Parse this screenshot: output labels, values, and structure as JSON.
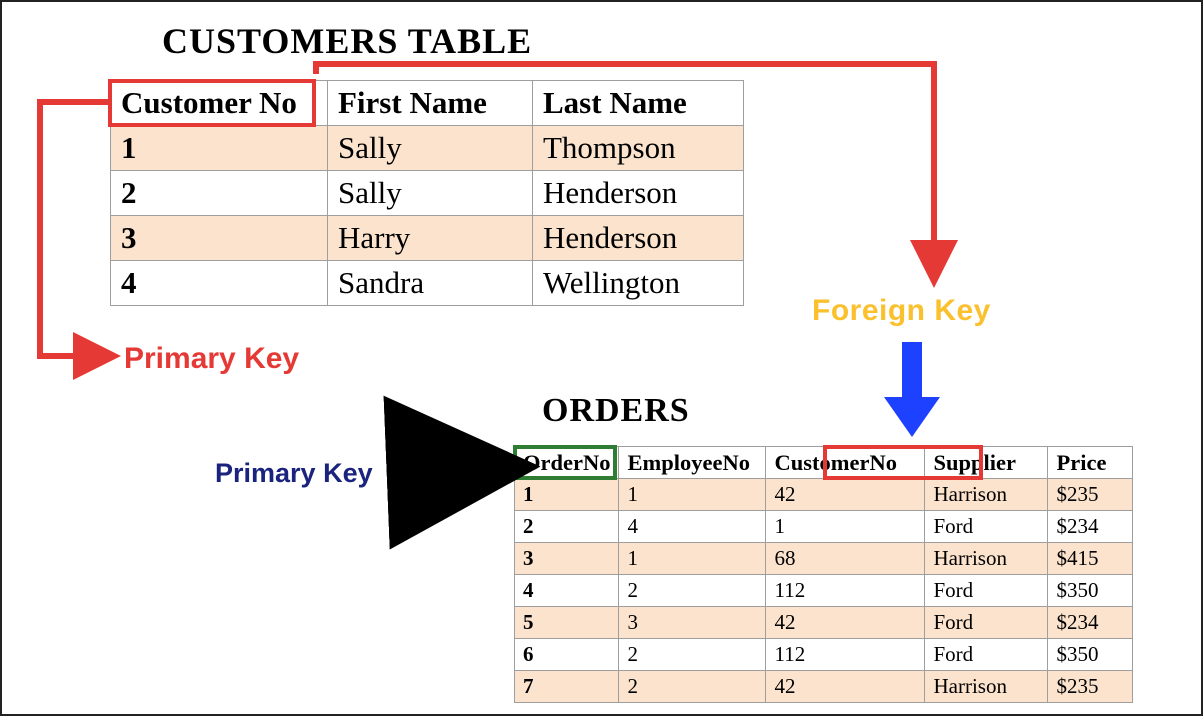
{
  "customers_table": {
    "title": "CUSTOMERS TABLE",
    "columns": [
      "Customer No",
      "First Name",
      "Last Name"
    ],
    "rows": [
      [
        "1",
        "Sally",
        "Thompson"
      ],
      [
        "2",
        "Sally",
        "Henderson"
      ],
      [
        "3",
        "Harry",
        "Henderson"
      ],
      [
        "4",
        "Sandra",
        "Wellington"
      ]
    ],
    "primary_key_column": 0
  },
  "orders_table": {
    "title": "ORDERS",
    "columns": [
      "OrderNo",
      "EmployeeNo",
      "CustomerNo",
      "Supplier",
      "Price"
    ],
    "rows": [
      [
        "1",
        "1",
        "42",
        "Harrison",
        "$235"
      ],
      [
        "2",
        "4",
        "1",
        "Ford",
        "$234"
      ],
      [
        "3",
        "1",
        "68",
        "Harrison",
        "$415"
      ],
      [
        "4",
        "2",
        "112",
        "Ford",
        "$350"
      ],
      [
        "5",
        "3",
        "42",
        "Ford",
        "$234"
      ],
      [
        "6",
        "2",
        "112",
        "Ford",
        "$350"
      ],
      [
        "7",
        "2",
        "42",
        "Harrison",
        "$235"
      ]
    ],
    "primary_key_column": 0,
    "foreign_key_column": 2,
    "foreign_key_references": "customers_table.Customer No"
  },
  "labels": {
    "primary_key": "Primary Key",
    "foreign_key": "Foreign Key"
  },
  "colors": {
    "pk_red": "#e53935",
    "pk_green": "#2e7d32",
    "fk_yellow": "#fbc02d",
    "fk_blue": "#1e40ff",
    "arrow_black": "#000000",
    "label_navy": "#1a237e"
  }
}
